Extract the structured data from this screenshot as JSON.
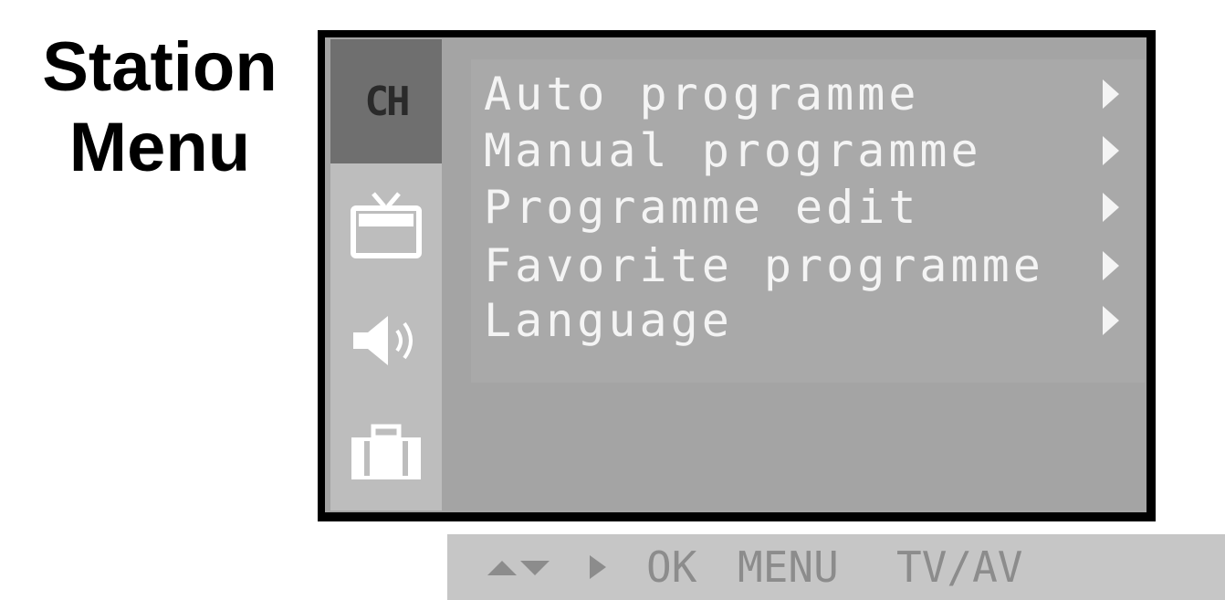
{
  "section_title": {
    "line1": "Station",
    "line2": "Menu"
  },
  "tabs": [
    {
      "label": "CH",
      "icon": "ch-tab",
      "selected": true
    },
    {
      "icon": "tv-icon"
    },
    {
      "icon": "speaker-icon"
    },
    {
      "icon": "toolbox-icon"
    }
  ],
  "menu": {
    "items": [
      {
        "label": "Auto programme"
      },
      {
        "label": "Manual programme"
      },
      {
        "label": "Programme edit"
      },
      {
        "label": "Favorite programme"
      },
      {
        "label": "Language"
      }
    ]
  },
  "help_bar": {
    "ok": "OK",
    "menu": "MENU",
    "tv_av": "TV/AV"
  },
  "colors": {
    "osd_background": "#a4a4a4",
    "osd_frame": "#000000",
    "selected_tab": "#6f6f6f",
    "menu_text": "#f4f4f4"
  }
}
